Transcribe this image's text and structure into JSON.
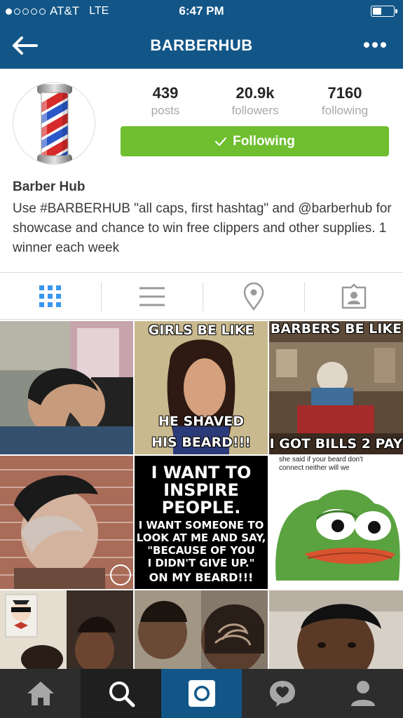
{
  "status_bar": {
    "carrier": "AT&T",
    "network": "LTE",
    "time": "6:47 PM",
    "signal_bars_filled": 1,
    "signal_bars_total": 5
  },
  "nav": {
    "title": "BARBERHUB",
    "back_icon": "arrow-left-icon",
    "more_icon": "more-dots-icon"
  },
  "profile": {
    "avatar_icon": "barber-pole-icon",
    "stats": [
      {
        "value": "439",
        "label": "posts"
      },
      {
        "value": "20.9k",
        "label": "followers"
      },
      {
        "value": "7160",
        "label": "following"
      }
    ],
    "follow_button_label": "Following",
    "follow_button_color": "#6fbe2f",
    "name": "Barber Hub",
    "bio": "Use #BARBERHUB \"all caps, first hashtag\" and @barberhub for showcase and chance to win free clippers and other supplies. 1 winner each week"
  },
  "view_tabs": [
    {
      "name": "grid-view",
      "icon": "grid-icon",
      "active": true
    },
    {
      "name": "list-view",
      "icon": "list-icon",
      "active": false
    },
    {
      "name": "map-view",
      "icon": "location-pin-icon",
      "active": false
    },
    {
      "name": "tagged-view",
      "icon": "tagged-photos-icon",
      "active": false
    }
  ],
  "posts": {
    "p2": {
      "top": "GIRLS BE LIKE",
      "bottom_1": "HE SHAVED",
      "bottom_2": "HIS BEARD!!!"
    },
    "p3": {
      "top": "BARBERS BE LIKE",
      "bottom": "I GOT BILLS 2 PAY"
    },
    "p5": {
      "l1": "I WANT TO",
      "l2": "INSPIRE",
      "l3": "PEOPLE.",
      "l4": "I WANT SOMEONE TO",
      "l5": "LOOK AT ME AND SAY,",
      "l6": "\"BECAUSE OF YOU",
      "l7": "I DIDN'T GIVE UP.\"",
      "l8": "ON MY BEARD!!!"
    },
    "p6": {
      "l1": "she said if your beard don't",
      "l2": "connect neither will we"
    }
  },
  "tab_bar": [
    {
      "name": "home",
      "icon": "home-icon"
    },
    {
      "name": "explore",
      "icon": "search-icon"
    },
    {
      "name": "camera",
      "icon": "camera-icon"
    },
    {
      "name": "activity",
      "icon": "activity-heart-icon"
    },
    {
      "name": "profile",
      "icon": "profile-icon"
    }
  ],
  "colors": {
    "brand_blue": "#125688",
    "active_tab_blue": "#3897f0",
    "tab_bar_bg": "#2d2d2d"
  }
}
